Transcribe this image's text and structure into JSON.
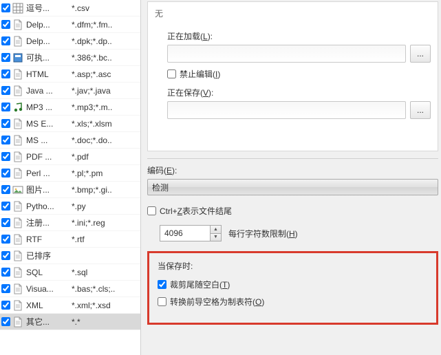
{
  "filetypes": [
    {
      "checked": true,
      "icon": "grid",
      "name": "逗号...",
      "ext": "*.csv",
      "sel": false
    },
    {
      "checked": true,
      "icon": "doc",
      "name": "Delp...",
      "ext": "*.dfm;*.fm..",
      "sel": false
    },
    {
      "checked": true,
      "icon": "doc",
      "name": "Delp...",
      "ext": "*.dpk;*.dp..",
      "sel": false
    },
    {
      "checked": true,
      "icon": "exe",
      "name": "可执...",
      "ext": "*.386;*.bc..",
      "sel": false
    },
    {
      "checked": true,
      "icon": "doc",
      "name": "HTML",
      "ext": "*.asp;*.asc",
      "sel": false
    },
    {
      "checked": true,
      "icon": "doc",
      "name": "Java ...",
      "ext": "*.jav;*.java",
      "sel": false
    },
    {
      "checked": true,
      "icon": "music",
      "name": "MP3 ...",
      "ext": "*.mp3;*.m..",
      "sel": false
    },
    {
      "checked": true,
      "icon": "doc",
      "name": "MS E...",
      "ext": "*.xls;*.xlsm",
      "sel": false
    },
    {
      "checked": true,
      "icon": "doc",
      "name": "MS ...",
      "ext": "*.doc;*.do..",
      "sel": false
    },
    {
      "checked": true,
      "icon": "doc",
      "name": "PDF ...",
      "ext": "*.pdf",
      "sel": false
    },
    {
      "checked": true,
      "icon": "doc",
      "name": "Perl ...",
      "ext": "*.pl;*.pm",
      "sel": false
    },
    {
      "checked": true,
      "icon": "pic",
      "name": "图片...",
      "ext": "*.bmp;*.gi..",
      "sel": false
    },
    {
      "checked": true,
      "icon": "doc",
      "name": "Pytho...",
      "ext": "*.py",
      "sel": false
    },
    {
      "checked": true,
      "icon": "doc",
      "name": "注册...",
      "ext": "*.ini;*.reg",
      "sel": false
    },
    {
      "checked": true,
      "icon": "doc",
      "name": "RTF",
      "ext": "*.rtf",
      "sel": false
    },
    {
      "checked": true,
      "icon": "doc",
      "name": "已排序",
      "ext": "",
      "sel": false
    },
    {
      "checked": true,
      "icon": "doc",
      "name": "SQL",
      "ext": "*.sql",
      "sel": false
    },
    {
      "checked": true,
      "icon": "doc",
      "name": "Visua...",
      "ext": "*.bas;*.cls;..",
      "sel": false
    },
    {
      "checked": true,
      "icon": "doc",
      "name": "XML",
      "ext": "*.xml;*.xsd",
      "sel": false
    },
    {
      "checked": true,
      "icon": "doc",
      "name": "其它...",
      "ext": "*.*",
      "sel": true
    }
  ],
  "right": {
    "none": "无",
    "loading_label_pre": "正在加载(",
    "loading_label_ul": "L",
    "loading_label_post": "):",
    "forbid_edit_pre": "禁止编辑(",
    "forbid_edit_ul": "I",
    "forbid_edit_post": ")",
    "saving_label_pre": "正在保存(",
    "saving_label_ul": "V",
    "saving_label_post": "):",
    "browse": "...",
    "encoding_label_pre": "编码(",
    "encoding_label_ul": "E",
    "encoding_label_post": "):",
    "encoding_value": "检测",
    "ctrlz_pre": "Ctrl+",
    "ctrlz_ul": "Z",
    "ctrlz_post": " 表示文件结尾",
    "spinner_value": "4096",
    "limit_label_pre": "每行字符数限制(",
    "limit_label_ul": "H",
    "limit_label_post": ")",
    "onsave_title": "当保存时:",
    "trim_pre": "裁剪尾随空白(",
    "trim_ul": "T",
    "trim_post": ")",
    "trim_checked": true,
    "convert_pre": "转换前导空格为制表符(",
    "convert_ul": "O",
    "convert_post": ")",
    "convert_checked": false,
    "forbid_checked": false,
    "ctrlz_checked": false
  }
}
